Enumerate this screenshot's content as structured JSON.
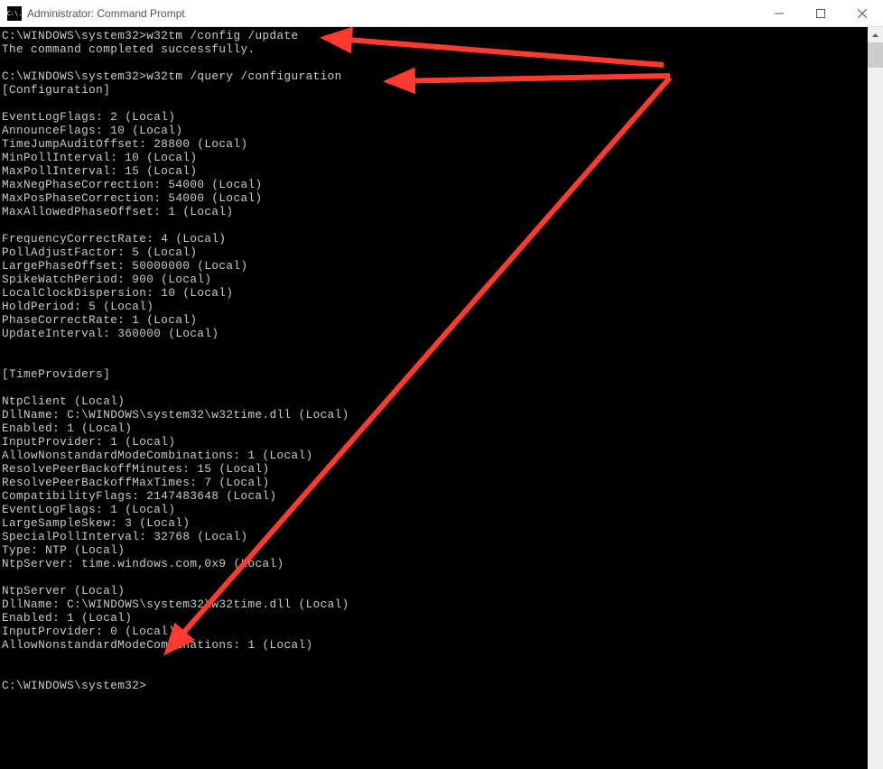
{
  "window": {
    "title": "Administrator: Command Prompt",
    "icon_label": "C:\\."
  },
  "prompt1": "C:\\WINDOWS\\system32>",
  "command1": "w32tm /config /update",
  "response1": "The command completed successfully.",
  "prompt2": "C:\\WINDOWS\\system32>",
  "command2": "w32tm /query /configuration",
  "section_config": "[Configuration]",
  "config_lines": {
    "l0": "EventLogFlags: 2 (Local)",
    "l1": "AnnounceFlags: 10 (Local)",
    "l2": "TimeJumpAuditOffset: 28800 (Local)",
    "l3": "MinPollInterval: 10 (Local)",
    "l4": "MaxPollInterval: 15 (Local)",
    "l5": "MaxNegPhaseCorrection: 54000 (Local)",
    "l6": "MaxPosPhaseCorrection: 54000 (Local)",
    "l7": "MaxAllowedPhaseOffset: 1 (Local)",
    "l8": "FrequencyCorrectRate: 4 (Local)",
    "l9": "PollAdjustFactor: 5 (Local)",
    "l10": "LargePhaseOffset: 50000000 (Local)",
    "l11": "SpikeWatchPeriod: 900 (Local)",
    "l12": "LocalClockDispersion: 10 (Local)",
    "l13": "HoldPeriod: 5 (Local)",
    "l14": "PhaseCorrectRate: 1 (Local)",
    "l15": "UpdateInterval: 360000 (Local)"
  },
  "section_time": "[TimeProviders]",
  "ntpclient_lines": {
    "l0": "NtpClient (Local)",
    "l1": "DllName: C:\\WINDOWS\\system32\\w32time.dll (Local)",
    "l2": "Enabled: 1 (Local)",
    "l3": "InputProvider: 1 (Local)",
    "l4": "AllowNonstandardModeCombinations: 1 (Local)",
    "l5": "ResolvePeerBackoffMinutes: 15 (Local)",
    "l6": "ResolvePeerBackoffMaxTimes: 7 (Local)",
    "l7": "CompatibilityFlags: 2147483648 (Local)",
    "l8": "EventLogFlags: 1 (Local)",
    "l9": "LargeSampleSkew: 3 (Local)",
    "l10": "SpecialPollInterval: 32768 (Local)",
    "l11": "Type: NTP (Local)",
    "l12": "NtpServer: time.windows.com,0x9 (Local)"
  },
  "ntpserver_lines": {
    "l0": "NtpServer (Local)",
    "l1": "DllName: C:\\WINDOWS\\system32\\w32time.dll (Local)",
    "l2": "Enabled: 1 (Local)",
    "l3": "InputProvider: 0 (Local)",
    "l4": "AllowNonstandardModeCombinations: 1 (Local)"
  },
  "prompt3": "C:\\WINDOWS\\system32>",
  "arrow_color": "#ff3b30"
}
